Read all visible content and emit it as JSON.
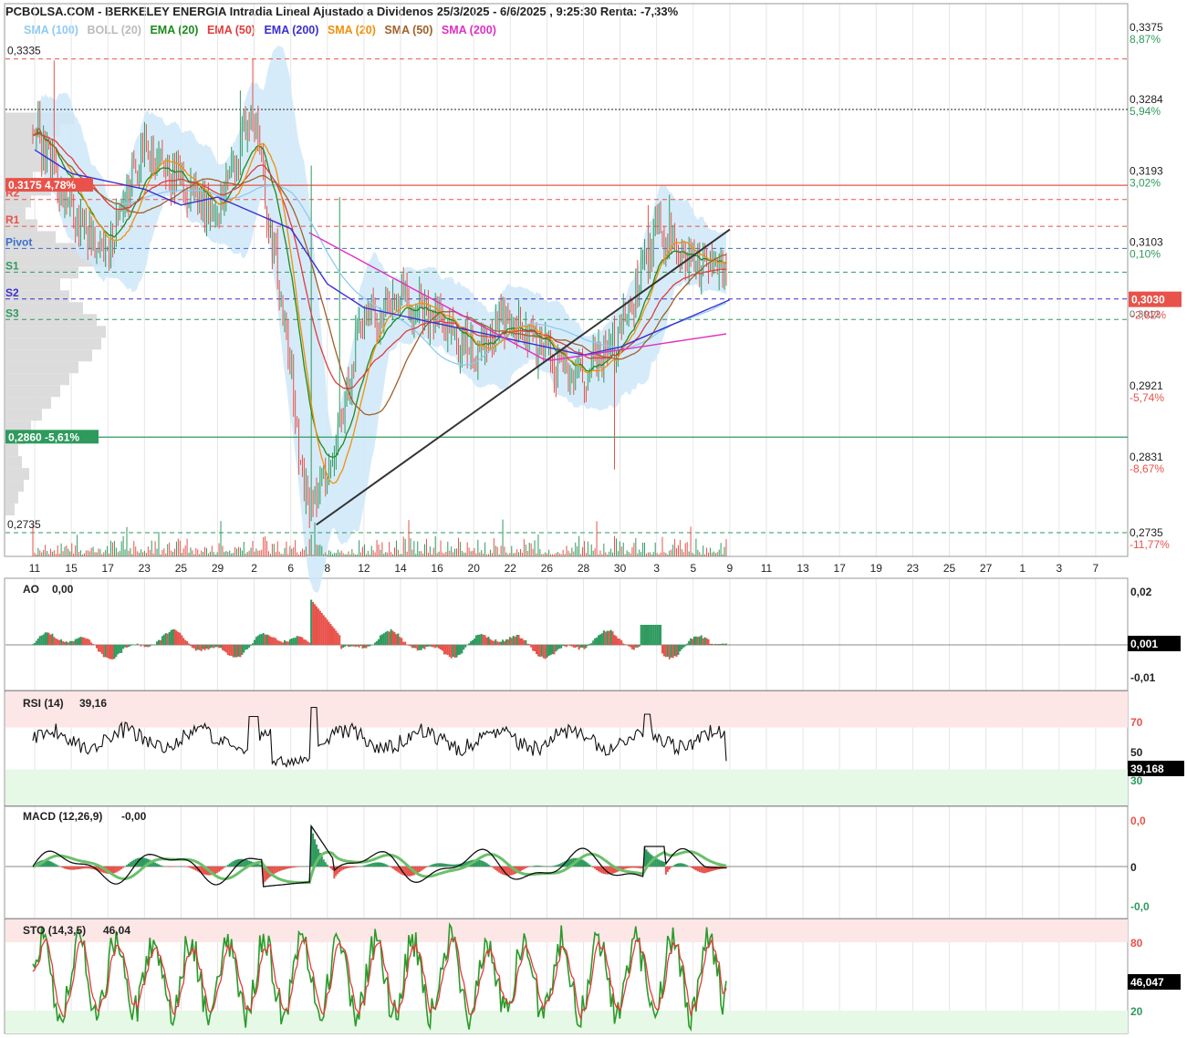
{
  "header": {
    "title": "PCBOLSA.COM - BERKELEY ENERGIA Intradia Lineal Ajustado a Dividenos 25/3/2025 - 6/6/2025 , 9:25:30 Renta: -7,33%"
  },
  "legend": [
    {
      "label": "SMA (100)",
      "color": "#8ecbf0"
    },
    {
      "label": "BOLL (20)",
      "color": "#bbbbbb"
    },
    {
      "label": "EMA (20)",
      "color": "#1e8a1e"
    },
    {
      "label": "EMA (50)",
      "color": "#e03c3c"
    },
    {
      "label": "EMA (200)",
      "color": "#3a2fd0"
    },
    {
      "label": "SMA (20)",
      "color": "#f0900a"
    },
    {
      "label": "SMA (50)",
      "color": "#a0602a"
    },
    {
      "label": "SMA (200)",
      "color": "#e030c0"
    }
  ],
  "colors": {
    "up": "#2e9a5e",
    "down": "#e8524a",
    "band": "#cfe8f8",
    "grid": "#e6e6e6",
    "resistance": "#e8524a",
    "support": "#2e9a5e",
    "pivot": "#3a6ed0"
  },
  "chart_data": [
    {
      "type": "line",
      "panel": "price",
      "x_labels": [
        "11",
        "15",
        "17",
        "23",
        "25",
        "29",
        "2",
        "6",
        "8",
        "12",
        "14",
        "16",
        "20",
        "22",
        "26",
        "28",
        "30",
        "3",
        "5",
        "9",
        "11",
        "13",
        "17",
        "19",
        "23",
        "25",
        "27",
        "1",
        "3",
        "7"
      ],
      "ylim": [
        0.2705,
        0.3405
      ],
      "price_ticks": [
        {
          "value": 0.3375,
          "label": "0,3375",
          "pct": "8,87%",
          "pct_color": "#2e9a5e"
        },
        {
          "value": 0.3284,
          "label": "0,3284",
          "pct": "5,94%",
          "pct_color": "#2e9a5e"
        },
        {
          "value": 0.3193,
          "label": "0,3193",
          "pct": "3,02%",
          "pct_color": "#2e9a5e"
        },
        {
          "value": 0.3103,
          "label": "0,3103",
          "pct": "0,10%",
          "pct_color": "#2e9a5e"
        },
        {
          "value": 0.2921,
          "label": "0,2921",
          "pct": "-5,74%",
          "pct_color": "#e8524a"
        },
        {
          "value": 0.2831,
          "label": "0,2831",
          "pct": "-8,67%",
          "pct_color": "#e8524a"
        },
        {
          "value": 0.2735,
          "label": "0,2735",
          "pct": "-11,77%",
          "pct_color": "#e8524a"
        }
      ],
      "levels": [
        {
          "name": "max",
          "label": "0,3335",
          "value": 0.3335,
          "color": "#e8524a",
          "style": "dash"
        },
        {
          "name": "prev-close",
          "label": "",
          "value": 0.3271,
          "color": "#222222",
          "style": "dot"
        },
        {
          "name": "hi-box",
          "label": "0,3175  4,78%",
          "value": 0.3175,
          "color": "#e8524a",
          "style": "solid"
        },
        {
          "name": "R2",
          "label": "R2",
          "value": 0.3157,
          "color": "#e8524a",
          "style": "dash"
        },
        {
          "name": "R1",
          "label": "R1",
          "value": 0.3123,
          "color": "#e8524a",
          "style": "dash"
        },
        {
          "name": "Pivot",
          "label": "Pivot",
          "value": 0.3095,
          "color": "#3a6ed0",
          "style": "dash"
        },
        {
          "name": "S1",
          "label": "S1",
          "value": 0.3065,
          "color": "#2e9a5e",
          "style": "dash"
        },
        {
          "name": "S2",
          "label": "S2",
          "value": 0.3031,
          "color": "#3a2fd0",
          "style": "dash"
        },
        {
          "name": "S3",
          "label": "S3",
          "value": 0.3005,
          "color": "#2e9a5e",
          "style": "dash"
        },
        {
          "name": "low-box",
          "label": "0,2860  -5,61%",
          "value": 0.2856,
          "color": "#2e9a5e",
          "style": "solid"
        },
        {
          "name": "min",
          "label": "0,2735",
          "value": 0.2735,
          "color": "#2e9a5e",
          "style": "dash"
        }
      ],
      "last_price": {
        "label": "0,3030",
        "value": 0.303,
        "pct": "-2,82%"
      },
      "extra_axis_label": "0,3012",
      "trendline": {
        "from": [
          7.7,
          0.2745
        ],
        "to": [
          19.0,
          0.3119
        ]
      },
      "series": [
        {
          "name": "Precio",
          "x": [
            0,
            1,
            2,
            3,
            4,
            5,
            6,
            7,
            7.5,
            8,
            9,
            10,
            11,
            12,
            13,
            14,
            15,
            16,
            17,
            18,
            19
          ],
          "y": [
            0.325,
            0.315,
            0.308,
            0.322,
            0.318,
            0.314,
            0.327,
            0.296,
            0.276,
            0.28,
            0.3,
            0.303,
            0.301,
            0.296,
            0.301,
            0.296,
            0.293,
            0.298,
            0.3115,
            0.308,
            0.3065
          ]
        },
        {
          "name": "EMA (200)",
          "x": [
            0,
            1,
            2,
            3,
            4,
            5,
            6,
            7,
            8,
            9,
            10,
            11,
            12,
            13,
            14,
            15,
            16,
            17,
            18,
            19
          ],
          "y": [
            0.322,
            0.319,
            0.318,
            0.317,
            0.315,
            0.316,
            0.314,
            0.312,
            0.305,
            0.302,
            0.301,
            0.3,
            0.299,
            0.298,
            0.297,
            0.296,
            0.297,
            0.299,
            0.301,
            0.303
          ]
        }
      ]
    },
    {
      "type": "bar",
      "panel": "AO",
      "label": "AO",
      "value_label": "0,00",
      "ylim": [
        -0.02,
        0.02
      ],
      "ticks": [
        "0,02",
        "-0,01"
      ],
      "last": "0,001"
    },
    {
      "type": "line",
      "panel": "RSI",
      "label": "RSI (14)",
      "value_label": "39,16",
      "ylim": [
        0,
        100
      ],
      "ticks": [
        "70",
        "50",
        "30"
      ],
      "last": "39,168"
    },
    {
      "type": "line",
      "panel": "MACD",
      "label": "MACD (12,26,9)",
      "value_label": "-0,00",
      "ticks": [
        "0,0",
        "0",
        "-0,0"
      ]
    },
    {
      "type": "line",
      "panel": "STO",
      "label": "STO (14,3,5)",
      "value_label": "46,04",
      "ylim": [
        0,
        100
      ],
      "ticks": [
        "80",
        "20"
      ],
      "last": "46,047"
    }
  ]
}
